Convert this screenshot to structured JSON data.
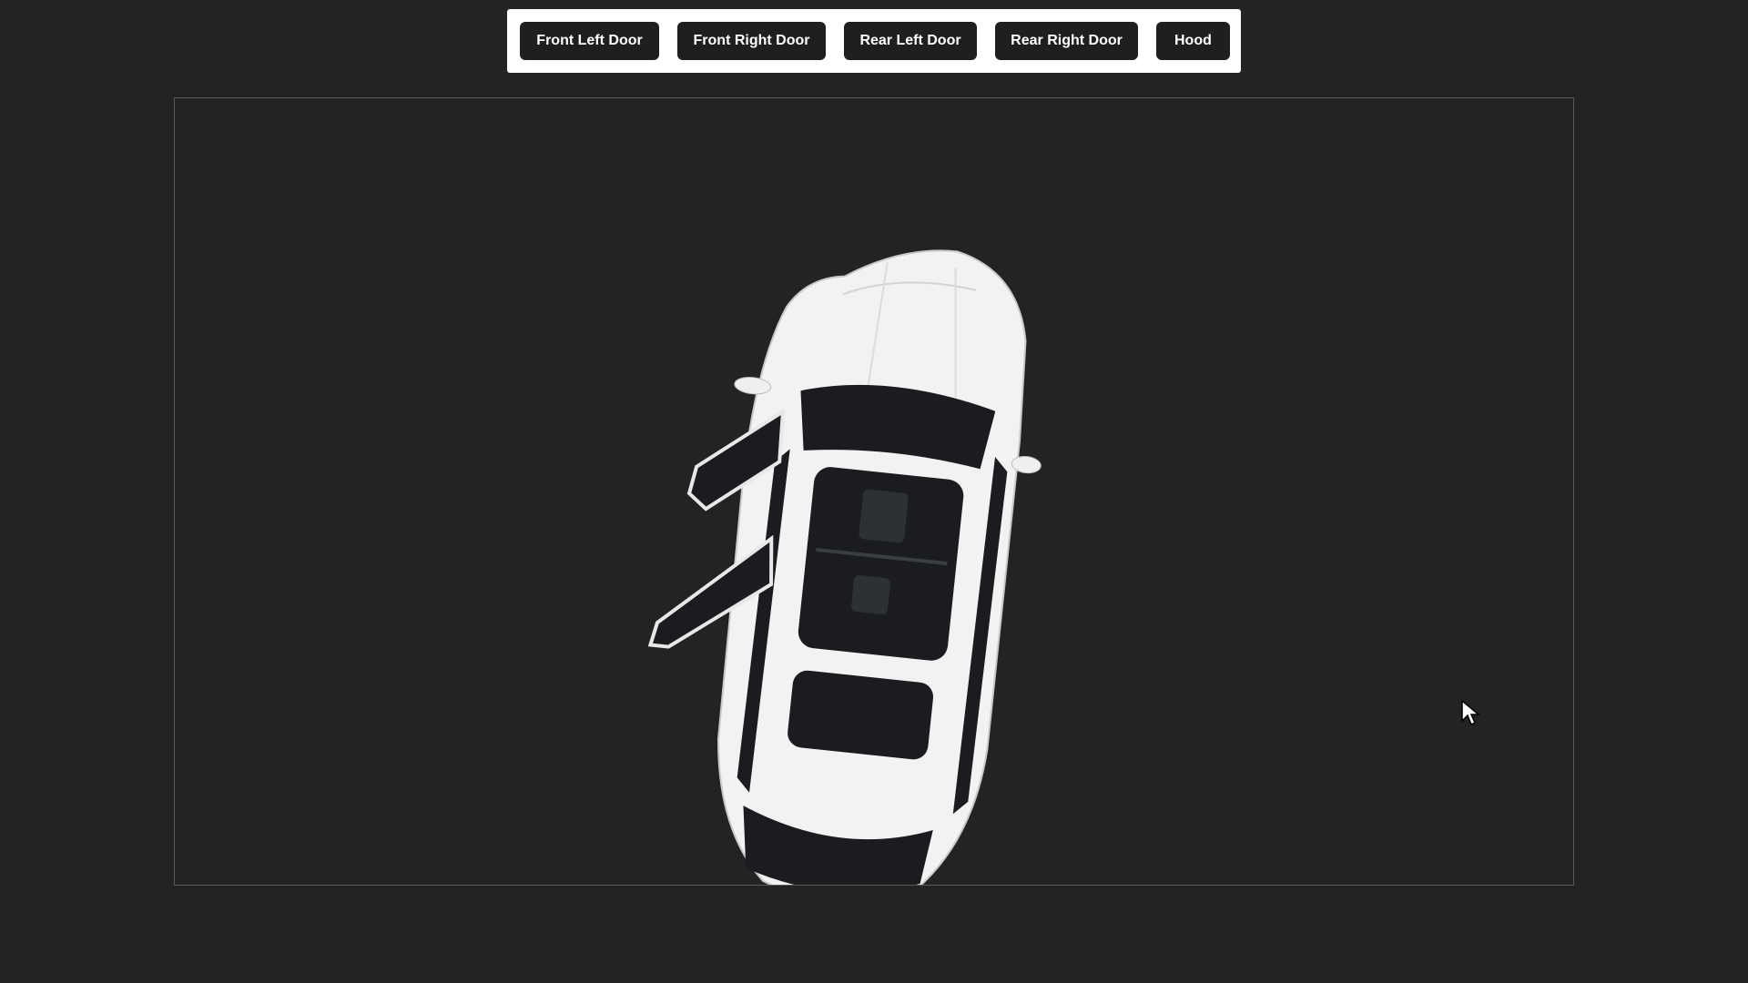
{
  "toolbar": {
    "buttons": [
      {
        "label": "Front Left Door"
      },
      {
        "label": "Front Right Door"
      },
      {
        "label": "Rear Left Door"
      },
      {
        "label": "Rear Right Door"
      },
      {
        "label": "Hood"
      }
    ]
  },
  "viewport": {
    "object_icon": "car-top-view",
    "car_color": "#f2f2f2",
    "glass_color": "#1a1c1f",
    "open_doors": [
      "front-left",
      "rear-left"
    ]
  },
  "cursor": {
    "icon": "arrow-pointer-icon"
  }
}
